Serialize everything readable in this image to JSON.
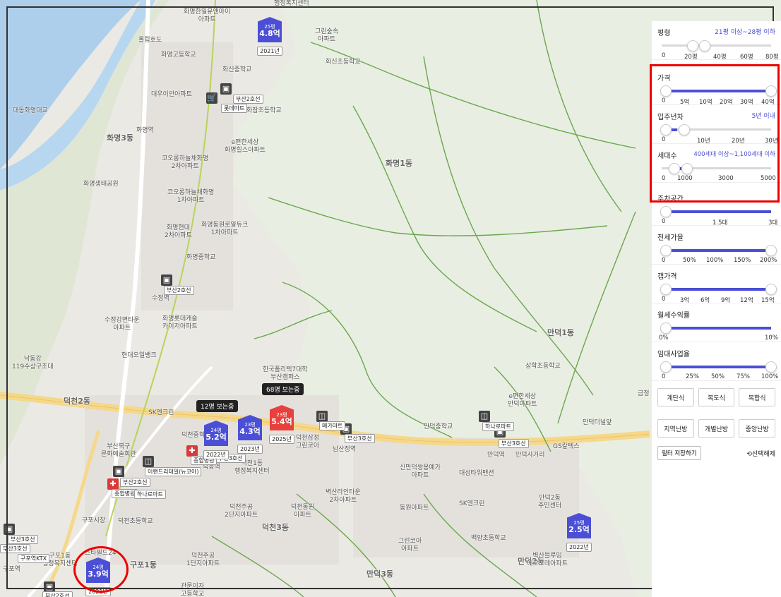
{
  "map": {
    "district_labels": [
      "화명3동",
      "화명1동",
      "만덕1동",
      "덕천2동",
      "덕천3동",
      "구포1동",
      "만덕2동",
      "만덕3동"
    ],
    "place_labels": [
      {
        "t": "화명한일유앤아이\n아파트"
      },
      {
        "t": "행정복지센터"
      },
      {
        "t": "그린숲속\n아파트"
      },
      {
        "t": "롤립호도"
      },
      {
        "t": "화명고등학교"
      },
      {
        "t": "화신중학교"
      },
      {
        "t": "화신초등학교"
      },
      {
        "t": "대우이안아파트"
      },
      {
        "t": "화잠초등학교"
      },
      {
        "t": "대동화명대교"
      },
      {
        "t": "화명역"
      },
      {
        "t": "e편한세상\n화명힐스아파트"
      },
      {
        "t": "코오롱하늘채화명\n2차아파트"
      },
      {
        "t": "화명생태공원"
      },
      {
        "t": "코오롱하늘채화명\n1차아파트"
      },
      {
        "t": "화명현대\n2차아파트"
      },
      {
        "t": "화명동원로얄듀크\n1차아파트"
      },
      {
        "t": "화명중학교"
      },
      {
        "t": "수정역"
      },
      {
        "t": "수정강변타운\n아파트"
      },
      {
        "t": "화명롯데캐슬\n카이저아파트"
      },
      {
        "t": "현대오일뱅크"
      },
      {
        "t": "낙동강\n119수상구조대"
      },
      {
        "t": "한국폴리텍7대학\n부산캠퍼스"
      },
      {
        "t": "SK엔크린"
      },
      {
        "t": "덕천중학교"
      },
      {
        "t": "부산북구\n문화예술회관"
      },
      {
        "t": "숙등역"
      },
      {
        "t": "덕천1동\n행정복지센터"
      },
      {
        "t": "남산정역"
      },
      {
        "t": "덕천삼정\n그린코아"
      },
      {
        "t": "덕천초등학교"
      },
      {
        "t": "구포시장"
      },
      {
        "t": "덕천주공\n2단지아파트"
      },
      {
        "t": "덕천주공\n1단지아파트"
      },
      {
        "t": "덕천동원\n아파트"
      },
      {
        "t": "벽산라인타운\n2차아파트"
      },
      {
        "t": "신만덕쌍용예가\n아파트"
      },
      {
        "t": "동원아파트"
      },
      {
        "t": "대성타워맨션"
      },
      {
        "t": "SK엔크린"
      },
      {
        "t": "만덕중학교"
      },
      {
        "t": "만덕역"
      },
      {
        "t": "GS칼텍스"
      },
      {
        "t": "만덕사거리"
      },
      {
        "t": "e편한세상\n만덕아파트"
      },
      {
        "t": "상학초등학교"
      },
      {
        "t": "만덕2동\n주민센터"
      },
      {
        "t": "그린코아\n아파트"
      },
      {
        "t": "백양초등학교"
      },
      {
        "t": "벽산블루밍\n에코포레아파트"
      },
      {
        "t": "구포역"
      },
      {
        "t": "구포1동\n행정복지센터"
      },
      {
        "t": "스타필드24"
      },
      {
        "t": "관문이자\n고등학교"
      },
      {
        "t": "만덕터널앞"
      },
      {
        "t": "금정"
      }
    ],
    "station_tags": [
      "부산2호선",
      "부산2호선",
      "부산3호선",
      "부산3호선",
      "부산3호선",
      "부산3호선",
      "부산2호선",
      "구포역KTX",
      "부산3호선",
      "부산2호선"
    ],
    "facility_tags": [
      "롯데마트",
      "메가마트",
      "하나로마트",
      "이랜드리테일(뉴코아)",
      "종합병원",
      "종합병원",
      "하나로마트"
    ],
    "apartments": [
      {
        "py": "25평",
        "price": "4.8억",
        "year": "2021년",
        "hot": false
      },
      {
        "py": "24평",
        "price": "5.2억",
        "year": "2022년",
        "hot": false
      },
      {
        "py": "23평",
        "price": "4.3억",
        "year": "2023년",
        "hot": false
      },
      {
        "py": "23평",
        "price": "5.4억",
        "year": "2025년",
        "hot": true
      },
      {
        "py": "25평",
        "price": "2.5억",
        "year": "2022년",
        "hot": false
      },
      {
        "py": "24평",
        "price": "3.9억",
        "year": "2021년",
        "hot": false
      }
    ],
    "viewers": [
      "12명 보는중",
      "68명 보는중"
    ]
  },
  "filters": {
    "pyeong": {
      "title": "평형",
      "range": "21평 이상~28평 이하",
      "ticks": [
        "0",
        "20평",
        "40평",
        "60평",
        "80평"
      ]
    },
    "price": {
      "title": "가격",
      "ticks": [
        "0",
        "5억",
        "10억",
        "20억",
        "30억",
        "40억"
      ]
    },
    "age": {
      "title": "입주년차",
      "range": "5년 이내",
      "ticks": [
        "0",
        "10년",
        "20년",
        "30년"
      ]
    },
    "households": {
      "title": "세대수",
      "range": "400세대 이상~1,100세대 이하",
      "ticks": [
        "0",
        "1000",
        "3000",
        "5000"
      ]
    },
    "parking": {
      "title": "주차공간",
      "ticks": [
        "0",
        "1.5대",
        "3대"
      ]
    },
    "jeonse": {
      "title": "전세가율",
      "ticks": [
        "0",
        "50%",
        "100%",
        "150%",
        "200%"
      ]
    },
    "gap": {
      "title": "갭가격",
      "ticks": [
        "0",
        "3억",
        "6억",
        "9억",
        "12억",
        "15억"
      ]
    },
    "rent_yield": {
      "title": "월세수익률",
      "ticks": [
        "0%",
        "10%"
      ]
    },
    "rental_biz": {
      "title": "임대사업율",
      "ticks": [
        "0",
        "25%",
        "50%",
        "75%",
        "100%"
      ]
    },
    "structure_buttons": [
      "계단식",
      "복도식",
      "복합식"
    ],
    "heating_buttons": [
      "지역난방",
      "개별난방",
      "중앙난방"
    ],
    "save_label": "필터 저장하기",
    "reset_label": "선택해제"
  }
}
